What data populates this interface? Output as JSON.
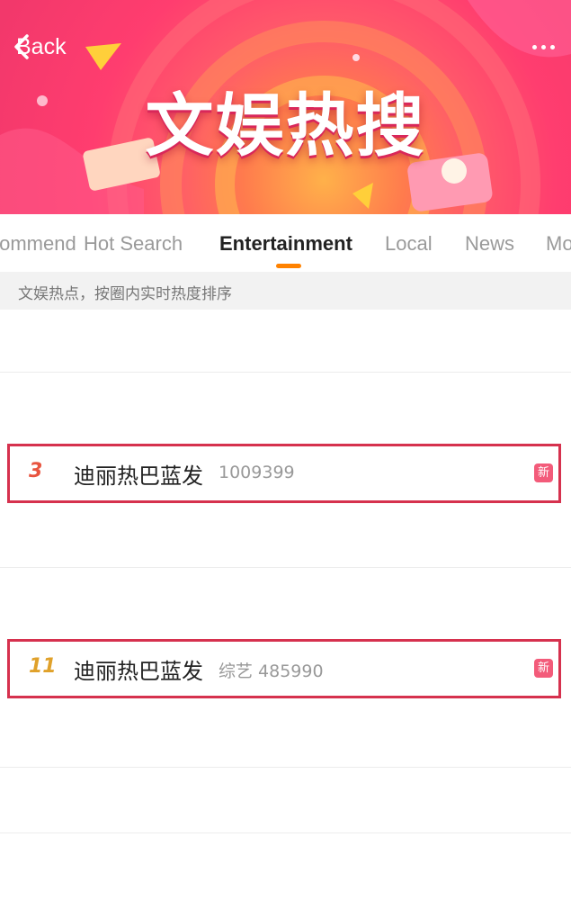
{
  "banner": {
    "back_label": "Back",
    "title": "文娱热搜"
  },
  "tabs": [
    {
      "label": "Recommend",
      "active": false
    },
    {
      "label": "Hot Search",
      "active": false
    },
    {
      "label": "Entertainment",
      "active": true
    },
    {
      "label": "Local",
      "active": false
    },
    {
      "label": "News",
      "active": false
    },
    {
      "label": "More",
      "active": false
    }
  ],
  "subheader": "文娱热点，按圈内实时热度排序",
  "rows": [
    {
      "rank": "3",
      "topic": "迪丽热巴蓝发",
      "meta": "1009399",
      "badge": "新",
      "rank_color": "#e8543f"
    },
    {
      "rank": "11",
      "topic": "迪丽热巴蓝发",
      "meta": "综艺 485990",
      "badge": "新",
      "rank_color": "#e0a12a"
    }
  ],
  "colors": {
    "accent": "#ff8200",
    "highlight_border": "#d6314e",
    "badge": "#f35b7a",
    "banner": "#ff3d6f"
  }
}
